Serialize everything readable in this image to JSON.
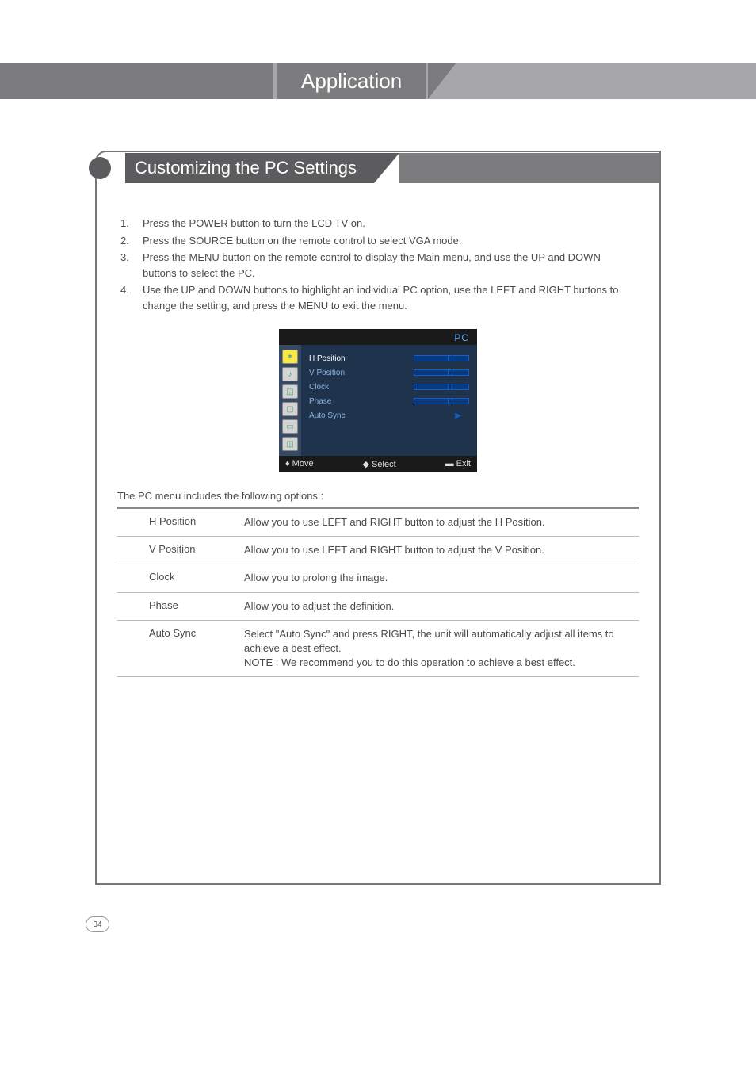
{
  "header": {
    "title": "Application"
  },
  "section": {
    "title": "Customizing the PC Settings"
  },
  "instructions": [
    {
      "num": "1.",
      "text": "Press the POWER button to turn the LCD TV on."
    },
    {
      "num": "2.",
      "text": "Press the SOURCE button on the remote control to select VGA mode."
    },
    {
      "num": "3.",
      "text": "Press the MENU button on the remote control to display the Main menu, and use the UP and DOWN buttons to select the PC."
    },
    {
      "num": "4.",
      "text": "Use the UP and DOWN buttons to highlight an individual PC option, use the LEFT and RIGHT buttons to change the setting, and press the MENU to exit the menu."
    }
  ],
  "osd": {
    "title": "PC",
    "items": [
      {
        "label": "H Position",
        "type": "slider",
        "selected": true
      },
      {
        "label": "V Position",
        "type": "slider"
      },
      {
        "label": "Clock",
        "type": "slider"
      },
      {
        "label": "Phase",
        "type": "slider"
      },
      {
        "label": "Auto Sync",
        "type": "arrow"
      }
    ],
    "footer": {
      "move": "Move",
      "select": "Select",
      "exit": "Exit"
    }
  },
  "table_intro": "The PC menu includes the following options :",
  "options": [
    {
      "name": "H Position",
      "desc": "Allow you to use LEFT and RIGHT button to adjust the H Position."
    },
    {
      "name": "V Position",
      "desc": "Allow you to use LEFT and RIGHT button to adjust the V Position."
    },
    {
      "name": "Clock",
      "desc": "Allow you to prolong the image."
    },
    {
      "name": "Phase",
      "desc": "Allow you to adjust the definition."
    },
    {
      "name": "Auto Sync",
      "desc": "Select \"Auto Sync\" and press RIGHT, the unit will automatically adjust all items to achieve a best effect.\nNOTE : We recommend you to do this operation to achieve a best effect."
    }
  ],
  "page_number": "34"
}
